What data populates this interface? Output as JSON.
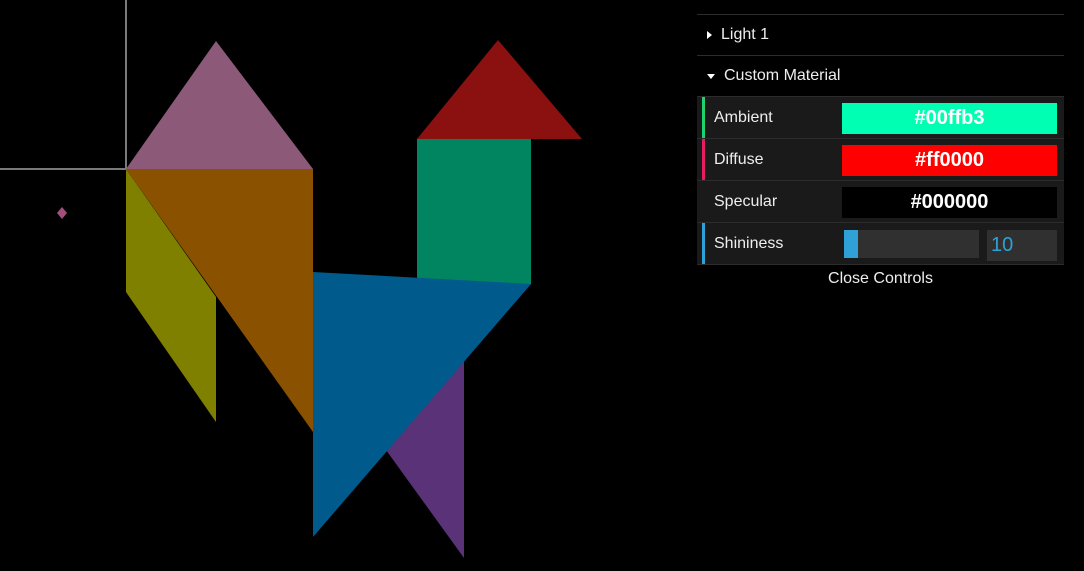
{
  "gui": {
    "light_folder": {
      "label": "Light 1"
    },
    "material_folder": {
      "label": "Custom Material"
    },
    "controls": {
      "ambient": {
        "label": "Ambient",
        "value": "#00ffb3",
        "stripe": "#1ed36f"
      },
      "diffuse": {
        "label": "Diffuse",
        "value": "#ff0000",
        "stripe": "#e61d5f"
      },
      "specular": {
        "label": "Specular",
        "value": "#000000"
      },
      "shininess": {
        "label": "Shininess",
        "value": "10",
        "fraction": 0.1,
        "stripe": "#2fa1d6"
      }
    },
    "close_label": "Close Controls"
  },
  "scene": {
    "pieces": {
      "pink_triangle": "#8c5a78",
      "orange_triangle": "#8a5200",
      "yellow_parallelogram": "#808000",
      "red_triangle": "#8b1010",
      "green_square": "#008560",
      "blue_triangle": "#005a8c",
      "purple_triangle": "#5a3278"
    }
  }
}
